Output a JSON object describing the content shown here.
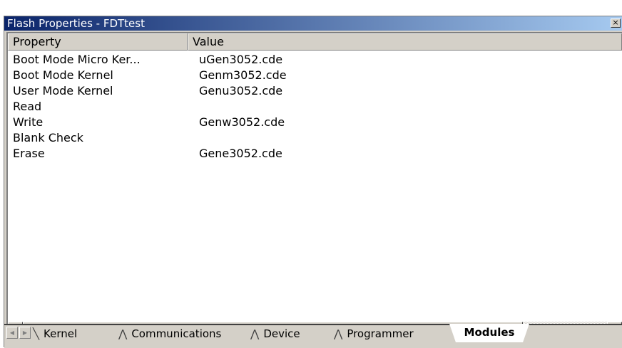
{
  "window": {
    "title": "Flash Properties - FDTtest",
    "close_label": "×"
  },
  "list": {
    "columns": [
      "Property",
      "Value"
    ],
    "rows": [
      {
        "property": "Boot Mode Micro Ker...",
        "value": "uGen3052.cde"
      },
      {
        "property": "Boot Mode Kernel",
        "value": "Genm3052.cde"
      },
      {
        "property": "User Mode Kernel",
        "value": "Genu3052.cde"
      },
      {
        "property": "Read",
        "value": ""
      },
      {
        "property": "Write",
        "value": "Genw3052.cde"
      },
      {
        "property": "Blank Check",
        "value": ""
      },
      {
        "property": "Erase",
        "value": "Gene3052.cde"
      }
    ]
  },
  "scrollbar": {
    "left_arrow": "◀",
    "right_arrow": "▶"
  },
  "tabs": {
    "nav_left": "◀",
    "nav_right": "▶",
    "items": [
      "Kernel",
      "Communications",
      "Device",
      "Programmer",
      "Modules"
    ],
    "active": "Modules"
  }
}
